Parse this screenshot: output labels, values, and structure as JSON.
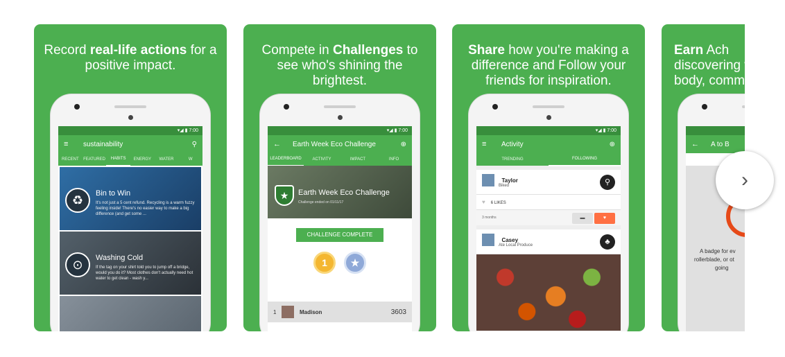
{
  "cards": [
    {
      "caption_pre": "Record ",
      "caption_bold": "real-life actions",
      "caption_post": " for a positive impact.",
      "status_time": "7:00",
      "appbar_title": "sustainability",
      "tabs": [
        "RECENT",
        "FEATURED",
        "HABITS",
        "ENERGY",
        "WATER",
        "W"
      ],
      "active_tab": "HABITS",
      "habits": [
        {
          "title": "Bin to Win",
          "body": "It's not just a 5 cent refund. Recycling is a warm fuzzy feeling inside! There's no easier way to make a big difference (and get some ...",
          "icon": "recycle-icon"
        },
        {
          "title": "Washing Cold",
          "body": "If the tag on your shirt told you to jump off a bridge, would you do it? Most clothes don't actually need hot water to get clean - wash y...",
          "icon": "washing-machine-icon"
        },
        {
          "title": "",
          "body": "",
          "icon": ""
        }
      ]
    },
    {
      "caption_pre": "Compete in ",
      "caption_bold": "Challenges",
      "caption_post": " to see who's shining the brightest.",
      "status_time": "7:00",
      "appbar_title": "Earth Week Eco Challenge",
      "tabs": [
        "LEADERBOARD",
        "ACTIVITY",
        "IMPACT",
        "INFO"
      ],
      "active_tab": "LEADERBOARD",
      "hero_title": "Earth Week Eco Challenge",
      "hero_sub": "Challenge ended on 01/11/17",
      "ribbon": "CHALLENGE COMPLETE",
      "medal_1": "1",
      "leader": {
        "rank": "1",
        "name": "Madison",
        "points": "3603"
      }
    },
    {
      "caption_bold": "Share",
      "caption_post": " how you're making a difference and Follow your friends for inspiration.",
      "status_time": "7:00",
      "appbar_title": "Activity",
      "tabs": [
        "TRENDING",
        "FOLLOWING"
      ],
      "active_tab": "FOLLOWING",
      "feed": [
        {
          "name": "Taylor",
          "action": "Biked",
          "icon": "bike-icon"
        },
        {
          "name": "Casey",
          "action": "Ate Local Produce",
          "icon": "produce-icon"
        }
      ],
      "likes": "6 LIKES",
      "time_ago": "3 months"
    },
    {
      "caption_bold": "Earn",
      "caption_line1_post": " Ach",
      "caption_line2": "discovering w",
      "caption_line3": "body, comm",
      "appbar_title": "A to B",
      "badge_text_1": "A badge for ev",
      "badge_text_2": "rollerblade, or ot",
      "badge_text_3": "going"
    }
  ],
  "next_button": {
    "label": "›"
  },
  "colors": {
    "brand_green": "#4caf50",
    "dark_green": "#388e3c"
  }
}
